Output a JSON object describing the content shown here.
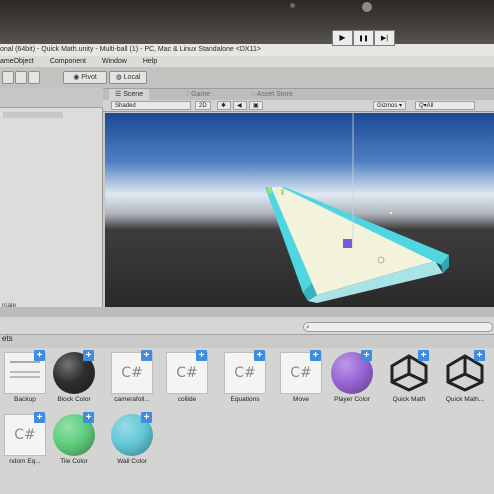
{
  "window": {
    "title": "onal (64bit) - Quick Math.unity - Multi-ball (1) - PC, Mac & Linux Standalone <DX11>"
  },
  "menu": [
    "ameObject",
    "Component",
    "Window",
    "Help"
  ],
  "toolbar": {
    "pivot_label": "Pivot",
    "local_label": "Local",
    "play_icon": "▶",
    "pause_icon": "❚❚",
    "step_icon": "▶|"
  },
  "scene": {
    "tabs": [
      "Scene",
      "Game",
      "Asset Store"
    ],
    "shading_label": "Shaded",
    "mode_2d_label": "2D",
    "gizmos_label": "Gizmos ▾",
    "search_label": "Q▾All"
  },
  "hierarchy": {
    "partial_label": "rcale"
  },
  "project": {
    "assets_label": "ets",
    "items": [
      {
        "label": "Backup",
        "type": "doc",
        "color": "#f2f2f0"
      },
      {
        "label": "Block Color",
        "type": "sphere",
        "color": "#2e2e2e"
      },
      {
        "label": "camerafoll...",
        "type": "script",
        "color": "#f4f4f2"
      },
      {
        "label": "collide",
        "type": "script",
        "color": "#f4f4f2"
      },
      {
        "label": "Equations",
        "type": "script",
        "color": "#f4f4f2"
      },
      {
        "label": "Move",
        "type": "script",
        "color": "#f4f4f2"
      },
      {
        "label": "Player Color",
        "type": "sphere",
        "color": "#9b66d6"
      },
      {
        "label": "Quick Math",
        "type": "unity",
        "color": "#ffffff"
      },
      {
        "label": "Quick Math...",
        "type": "unity",
        "color": "#ffffff"
      },
      {
        "label": "ndom Eq...",
        "type": "script",
        "color": "#f4f4f2"
      },
      {
        "label": "Tile Color",
        "type": "sphere",
        "color": "#5fcf7c"
      },
      {
        "label": "Wall Color",
        "type": "sphere",
        "color": "#63c9d8"
      }
    ],
    "script_glyph": "C#",
    "plus_glyph": "+"
  },
  "colors": {
    "track_wall": "#4fd6e0",
    "track_floor": "#f3f2da",
    "player": "#7b5ad6",
    "sky_top": "#1f4ea0"
  }
}
